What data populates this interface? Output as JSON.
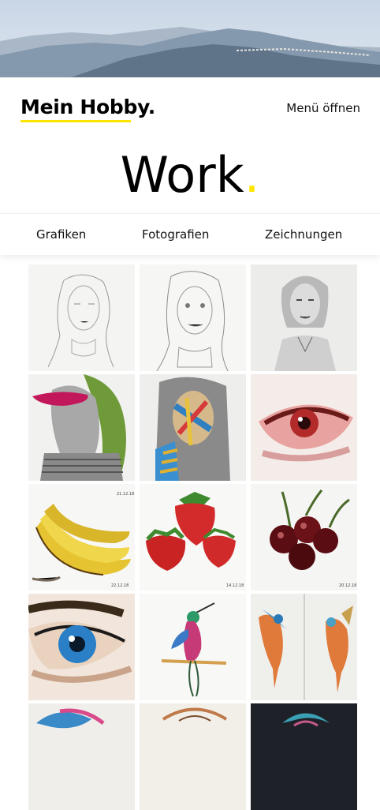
{
  "brand": {
    "name": "Mein Hobby",
    "dot": "."
  },
  "header": {
    "menu_label": "Menü öffnen"
  },
  "page": {
    "title": "Work",
    "title_dot": "."
  },
  "tabs": [
    {
      "label": "Grafiken"
    },
    {
      "label": "Fotografien"
    },
    {
      "label": "Zeichnungen"
    }
  ],
  "gallery": {
    "items": [
      {
        "subject": "pencil-sketch-woman-1"
      },
      {
        "subject": "pencil-sketch-woman-2"
      },
      {
        "subject": "pencil-portrait-woman"
      },
      {
        "subject": "sketch-girl-pink-paint"
      },
      {
        "subject": "colorful-face-drawing"
      },
      {
        "subject": "painted-eye-red"
      },
      {
        "subject": "bananas-painting",
        "date_left": "21.12.18",
        "date_right": "22.12.18"
      },
      {
        "subject": "strawberries-painting",
        "date": "14.12.18"
      },
      {
        "subject": "cherries-painting",
        "date": "20.12.18"
      },
      {
        "subject": "blue-eye-painting"
      },
      {
        "subject": "hummingbird-painting"
      },
      {
        "subject": "two-birds-painting"
      },
      {
        "subject": "flower-painting"
      },
      {
        "subject": "face-sketch-color"
      },
      {
        "subject": "dark-blue-painting"
      }
    ]
  },
  "colors": {
    "accent": "#ffe600",
    "text": "#111111"
  }
}
